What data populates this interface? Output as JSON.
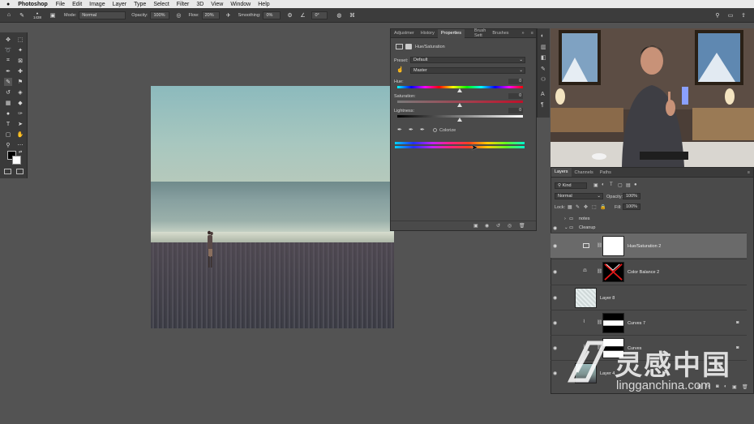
{
  "menubar": {
    "apple": "",
    "app": "Photoshop",
    "items": [
      "File",
      "Edit",
      "Image",
      "Layer",
      "Type",
      "Select",
      "Filter",
      "3D",
      "View",
      "Window",
      "Help"
    ]
  },
  "options": {
    "brush_size": "1438",
    "mode_label": "Mode:",
    "mode_value": "Normal",
    "opacity_label": "Opacity:",
    "opacity_value": "100%",
    "flow_label": "Flow:",
    "flow_value": "20%",
    "smoothing_label": "Smoothing:",
    "smoothing_value": "0%",
    "angle_value": "0°"
  },
  "properties": {
    "tabs": [
      "Adjustmer",
      "History",
      "Properties",
      "Brush Sett",
      "Brushes"
    ],
    "active_tab": "Properties",
    "title": "Hue/Saturation",
    "preset_label": "Preset:",
    "preset_value": "Default",
    "channel_value": "Master",
    "hue_label": "Hue:",
    "hue_value": "0",
    "saturation_label": "Saturation:",
    "saturation_value": "0",
    "lightness_label": "Lightness:",
    "lightness_value": "0",
    "colorize_label": "Colorize"
  },
  "layers": {
    "tabs": [
      "Layers",
      "Channels",
      "Paths"
    ],
    "kind_label": "Kind",
    "blend_value": "Normal",
    "opacity_label": "Opacity:",
    "opacity_value": "100%",
    "lock_label": "Lock:",
    "fill_label": "Fill:",
    "fill_value": "100%",
    "groups": [
      {
        "name": "notes"
      },
      {
        "name": "Cleanup"
      }
    ],
    "rows": [
      {
        "name": "Hue/Saturation 2"
      },
      {
        "name": "Color Balance 2"
      },
      {
        "name": "Layer 8"
      },
      {
        "name": "Curves 7"
      },
      {
        "name": "Curves"
      },
      {
        "name": "Layer 4"
      }
    ]
  },
  "watermark": {
    "cn": "灵感中国",
    "domain": "lingganchina.com"
  },
  "colors": {
    "menubar": "#e8e8e8",
    "panel": "#4a4a4a",
    "canvas_bg": "#535353",
    "selected_layer": "#6a6a6a"
  }
}
